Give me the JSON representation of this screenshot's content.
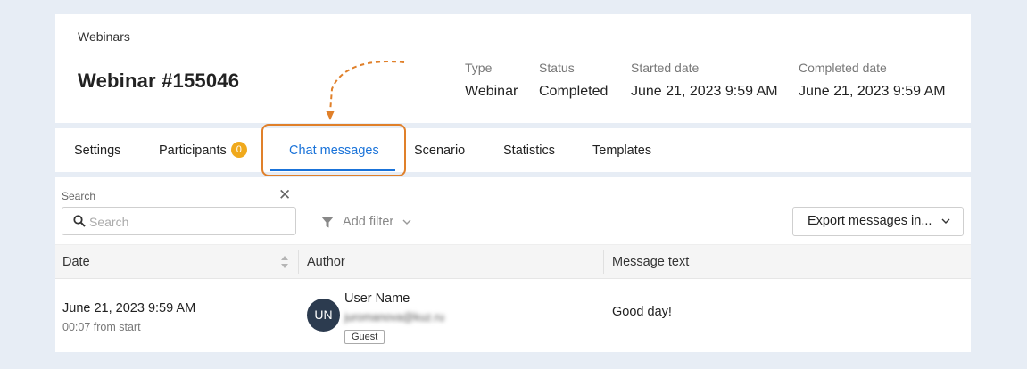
{
  "header": {
    "breadcrumb": "Webinars",
    "title": "Webinar #155046",
    "meta": [
      {
        "label": "Type",
        "value": "Webinar"
      },
      {
        "label": "Status",
        "value": "Completed"
      },
      {
        "label": "Started date",
        "value": "June 21, 2023 9:59 AM"
      },
      {
        "label": "Completed date",
        "value": "June 21, 2023 9:59 AM"
      }
    ]
  },
  "tabs": [
    {
      "label": "Settings"
    },
    {
      "label": "Participants",
      "badge": "0"
    },
    {
      "label": "Chat messages",
      "active": true
    },
    {
      "label": "Scenario"
    },
    {
      "label": "Statistics"
    },
    {
      "label": "Templates"
    }
  ],
  "toolbar": {
    "search_label": "Search",
    "search_placeholder": "Search",
    "search_value": "",
    "add_filter_label": "Add filter",
    "export_label": "Export messages in..."
  },
  "table": {
    "columns": [
      "Date",
      "Author",
      "Message text"
    ],
    "rows": [
      {
        "date": "June 21, 2023 9:59 AM",
        "offset": "00:07 from start",
        "avatar_initials": "UN",
        "author_name": "User Name",
        "author_email": "juromanova@kuz.ru",
        "author_role": "Guest",
        "message": "Good day!"
      }
    ]
  },
  "colors": {
    "accent": "#1a73d9",
    "badge": "#f0a91c",
    "highlight": "#e0802a",
    "avatar": "#2c3b4f",
    "background": "#e7edf5"
  },
  "icons": [
    "search-icon",
    "close-icon",
    "filter-icon",
    "chevron-down-icon",
    "sort-icon",
    "annotation-arrow"
  ]
}
